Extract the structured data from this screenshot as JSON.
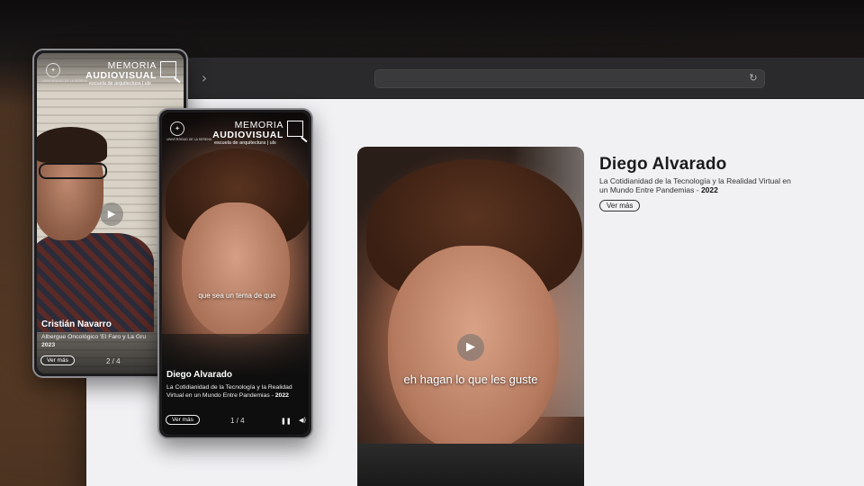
{
  "browser": {
    "nav_forward_icon": "chevron-right-icon",
    "reload_icon": "reload-icon"
  },
  "desktop": {
    "subtitle": "eh hagan lo que les guste",
    "person_name": "Diego Alvarado",
    "description": "La Cotidianidad de la Tecnología y la Realidad Virtual en un Mundo Entre Pandemias - ",
    "year": "2022",
    "more_button": "Ver más"
  },
  "brand": {
    "line1": "MEMORIA",
    "line2": "AUDIOVISUAL",
    "tagline": "escuela de arquitectura | uls",
    "seal_text": "UNIVERSIDAD DE LA SERENA"
  },
  "phone_a": {
    "person_name": "Cristián Navarro",
    "description": "Albergue Oncológico 'El Faro y La Gru",
    "year": "2023",
    "more_button": "Ver más",
    "counter": "2 / 4"
  },
  "phone_b": {
    "subtitle": "que sea un tema de que",
    "person_name": "Diego Alvarado",
    "description": "La Cotidianidad de la Tecnología y la Realidad Virtual en un Mundo Entre Pandemias - ",
    "year": "2022",
    "more_button": "Ver más",
    "counter": "1 / 4"
  },
  "colors": {
    "page_bg": "#f1f1f4",
    "browser_bar": "#2a2a2c",
    "desk_background": "#3d2a1e"
  }
}
